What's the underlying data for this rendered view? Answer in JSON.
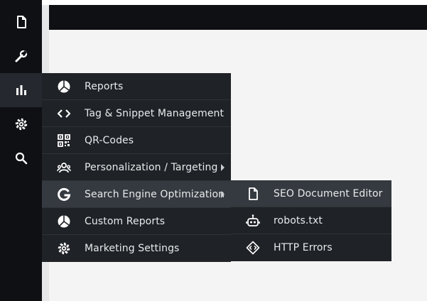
{
  "rail": {
    "items": [
      {
        "icon": "document-icon"
      },
      {
        "icon": "wrench-icon"
      },
      {
        "icon": "bar-chart-icon"
      },
      {
        "icon": "gear-icon"
      },
      {
        "icon": "search-icon"
      }
    ]
  },
  "menu": {
    "items": [
      {
        "label": "Reports",
        "icon": "pie-chart-icon"
      },
      {
        "label": "Tag & Snippet Management",
        "icon": "code-icon"
      },
      {
        "label": "QR-Codes",
        "icon": "qr-code-icon"
      },
      {
        "label": "Personalization / Targeting",
        "icon": "users-icon",
        "has_submenu": true
      },
      {
        "label": "Search Engine Optimization",
        "icon": "google-icon",
        "has_submenu": true,
        "highlighted": true
      },
      {
        "label": "Custom Reports",
        "icon": "pie-chart-icon"
      },
      {
        "label": "Marketing Settings",
        "icon": "gear-icon"
      }
    ]
  },
  "submenu": {
    "items": [
      {
        "label": "SEO Document Editor",
        "icon": "document-icon",
        "highlighted": true
      },
      {
        "label": "robots.txt",
        "icon": "robot-icon"
      },
      {
        "label": "HTTP Errors",
        "icon": "diamond-code-icon"
      }
    ]
  },
  "colors": {
    "rail_bg": "#0e1014",
    "menu_bg": "#1f2226",
    "menu_highlight": "#353a40",
    "text": "#e8eaec"
  }
}
